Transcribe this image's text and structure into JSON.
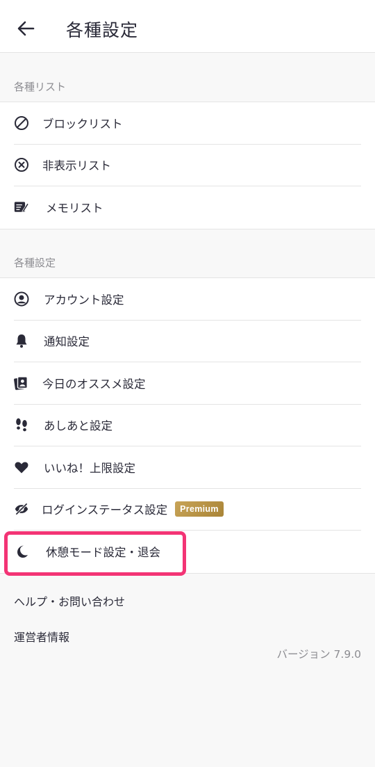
{
  "header": {
    "title": "各種設定",
    "back_icon": "arrow-left-icon"
  },
  "list_section": {
    "label": "各種リスト",
    "items": [
      {
        "label": "ブロックリスト",
        "icon": "block-icon"
      },
      {
        "label": "非表示リスト",
        "icon": "hide-icon"
      },
      {
        "label": "メモリスト",
        "icon": "memo-icon"
      }
    ]
  },
  "settings_section": {
    "label": "各種設定",
    "items": [
      {
        "label": "アカウント設定",
        "icon": "account-icon"
      },
      {
        "label": "通知設定",
        "icon": "bell-icon"
      },
      {
        "label": "今日のオススメ設定",
        "icon": "cards-icon"
      },
      {
        "label": "あしあと設定",
        "icon": "footprint-icon"
      },
      {
        "label": "いいね！上限設定",
        "icon": "heart-icon"
      },
      {
        "label": "ログインステータス設定",
        "icon": "eye-slash-icon",
        "badge": "Premium"
      },
      {
        "label": "休憩モード設定・退会",
        "icon": "moon-icon"
      }
    ]
  },
  "links": {
    "help": "ヘルプ・お問い合わせ",
    "operator": "運営者情報"
  },
  "version": "バージョン 7.9.0",
  "colors": {
    "highlight": "#f33475",
    "premium_badge": "#b99445",
    "text": "#2a2a38",
    "muted": "#8d8d92"
  }
}
